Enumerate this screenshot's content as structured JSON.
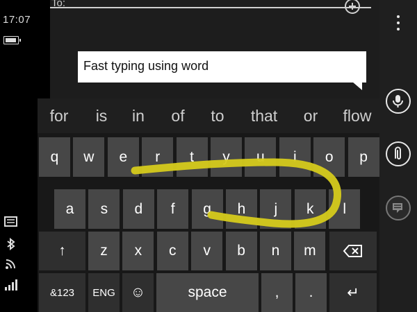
{
  "status": {
    "time": "17:07"
  },
  "compose": {
    "to_label": "To:",
    "message_text": "Fast typing using word"
  },
  "suggestions": [
    "for",
    "is",
    "in",
    "of",
    "to",
    "that",
    "or",
    "flow"
  ],
  "keyboard": {
    "row1": [
      "q",
      "w",
      "e",
      "r",
      "t",
      "y",
      "u",
      "i",
      "o",
      "p"
    ],
    "row2": [
      "a",
      "s",
      "d",
      "f",
      "g",
      "h",
      "j",
      "k",
      "l"
    ],
    "row3": [
      "z",
      "x",
      "c",
      "v",
      "b",
      "n",
      "m"
    ],
    "shift_glyph": "↑",
    "numbers_label": "&123",
    "language_label": "ENG",
    "emoji_glyph": "☺",
    "space_label": "space",
    "comma_label": ",",
    "period_label": ".",
    "enter_glyph": "↵"
  },
  "colors": {
    "swipe_trail": "#d6cb1c",
    "key_bg": "#474747",
    "key_dark_bg": "#2f2f2f",
    "background": "#000000"
  },
  "icons": {
    "app_bar": [
      "more-icon",
      "microphone-icon",
      "attachment-icon",
      "quick-reply-icon"
    ],
    "status": [
      "battery-icon",
      "message-icon",
      "bluetooth-icon",
      "wifi-icon",
      "signal-icon"
    ]
  }
}
